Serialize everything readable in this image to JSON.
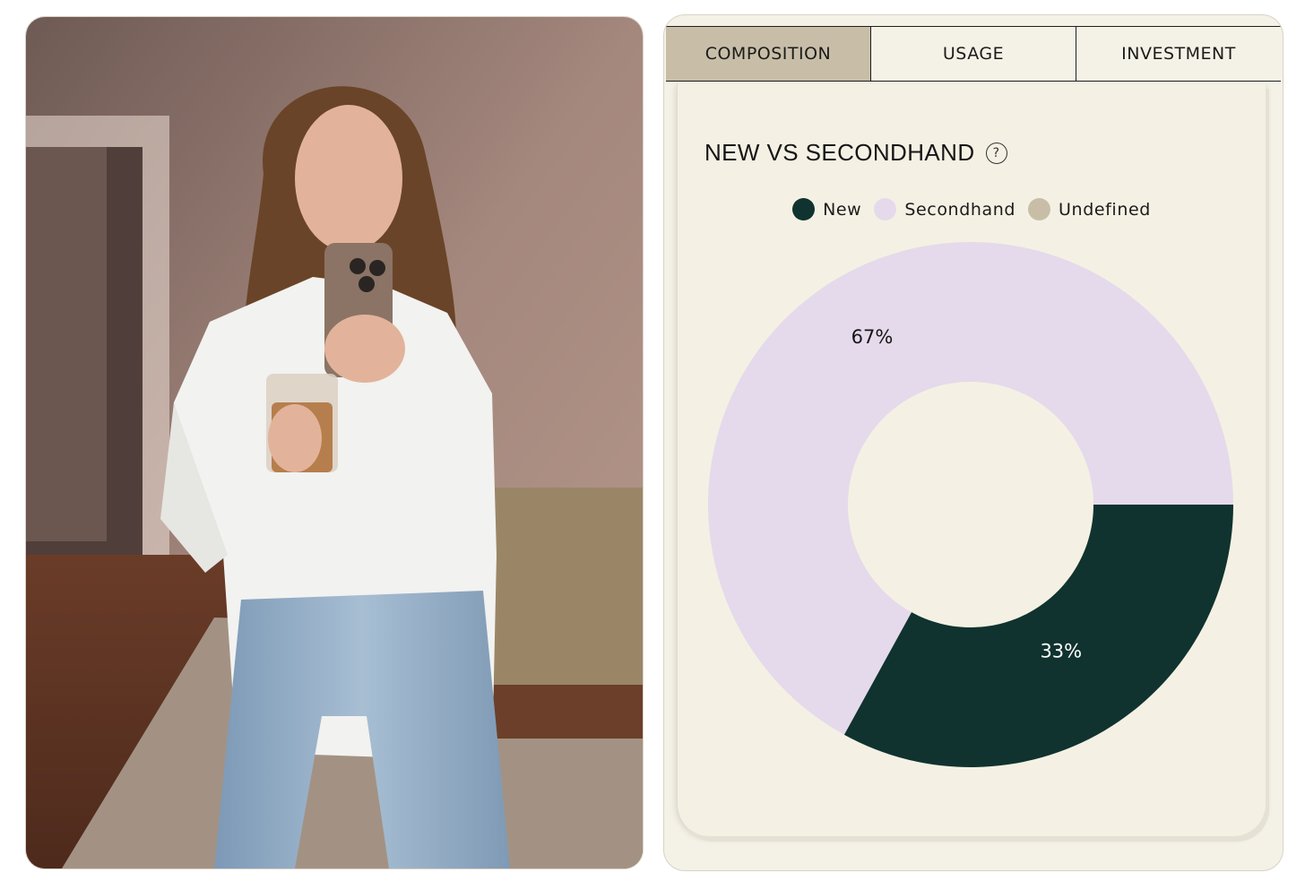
{
  "photo": {
    "alt": "",
    "description": ""
  },
  "tabs": [
    {
      "label": "COMPOSITION",
      "active": true
    },
    {
      "label": "USAGE",
      "active": false
    },
    {
      "label": "INVESTMENT",
      "active": false
    }
  ],
  "card": {
    "title": "NEW VS SECONDHAND",
    "help_icon": "question-circle-icon"
  },
  "colors": {
    "new": "#10332f",
    "secondhand": "#e5daeb",
    "undefined": "#c8bea8",
    "active_tab": "#c8bea8",
    "panel_bg": "#f4f1e6"
  },
  "chart_data": {
    "type": "pie",
    "title": "NEW VS SECONDHAND",
    "legend_position": "top-center",
    "series": [
      {
        "name": "New",
        "value": 33,
        "label": "33%"
      },
      {
        "name": "Secondhand",
        "value": 67,
        "label": "67%"
      },
      {
        "name": "Undefined",
        "value": 0,
        "label": ""
      }
    ]
  }
}
